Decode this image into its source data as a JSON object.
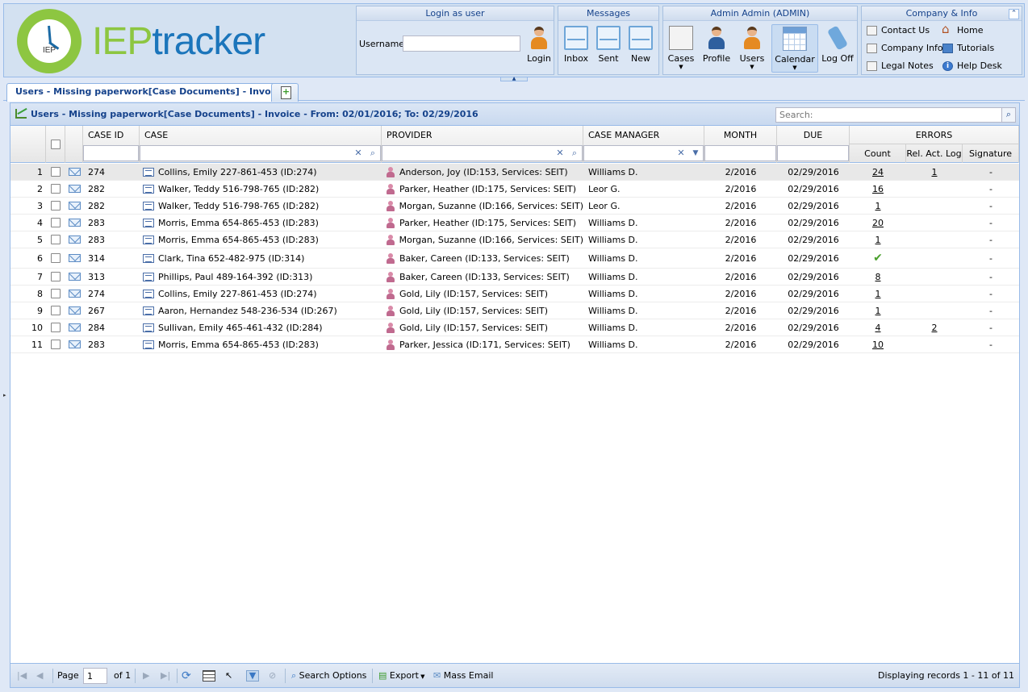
{
  "logo": {
    "badge": "IEP",
    "prefix": "IEP",
    "suffix": "tracker"
  },
  "login_group": {
    "title": "Login as user",
    "username_label": "Username:",
    "username_value": "",
    "login_label": "Login"
  },
  "messages_group": {
    "title": "Messages",
    "inbox": "Inbox",
    "sent": "Sent",
    "new": "New"
  },
  "admin_group": {
    "title": "Admin Admin (ADMIN)",
    "cases": "Cases",
    "profile": "Profile",
    "users": "Users",
    "calendar": "Calendar",
    "logoff": "Log Off"
  },
  "company_group": {
    "title": "Company & Info",
    "contact": "Contact Us",
    "home": "Home",
    "company_info": "Company Info",
    "tutorials": "Tutorials",
    "legal": "Legal Notes",
    "help": "Help Desk"
  },
  "tabs": [
    {
      "label": "Users - Missing paperwork[Case Documents] - Invoice"
    }
  ],
  "panel": {
    "title": "Users - Missing paperwork[Case Documents] - Invoice - From: 02/01/2016; To: 02/29/2016",
    "search_placeholder": "Search:"
  },
  "columns": {
    "case_id": "CASE ID",
    "case": "CASE",
    "provider": "PROVIDER",
    "case_manager": "CASE MANAGER",
    "month": "MONTH",
    "due": "DUE",
    "errors": "ERRORS",
    "count": "Count",
    "rel_act_log": "Rel. Act. Log",
    "signature": "Signature"
  },
  "rows": [
    {
      "n": "1",
      "case_id": "274",
      "case": "Collins, Emily 227-861-453 (ID:274)",
      "provider": "Anderson, Joy (ID:153, Services: SEIT)",
      "manager": "Williams D.",
      "month": "2/2016",
      "due": "02/29/2016",
      "count": "24",
      "rel": "1",
      "sig": "-"
    },
    {
      "n": "2",
      "case_id": "282",
      "case": "Walker, Teddy 516-798-765 (ID:282)",
      "provider": "Parker, Heather (ID:175, Services: SEIT)",
      "manager": "Leor G.",
      "month": "2/2016",
      "due": "02/29/2016",
      "count": "16",
      "rel": "",
      "sig": "-"
    },
    {
      "n": "3",
      "case_id": "282",
      "case": "Walker, Teddy 516-798-765 (ID:282)",
      "provider": "Morgan, Suzanne (ID:166, Services: SEIT)",
      "manager": "Leor G.",
      "month": "2/2016",
      "due": "02/29/2016",
      "count": "1",
      "rel": "",
      "sig": "-"
    },
    {
      "n": "4",
      "case_id": "283",
      "case": "Morris, Emma 654-865-453 (ID:283)",
      "provider": "Parker, Heather (ID:175, Services: SEIT)",
      "manager": "Williams D.",
      "month": "2/2016",
      "due": "02/29/2016",
      "count": "20",
      "rel": "",
      "sig": "-"
    },
    {
      "n": "5",
      "case_id": "283",
      "case": "Morris, Emma 654-865-453 (ID:283)",
      "provider": "Morgan, Suzanne (ID:166, Services: SEIT)",
      "manager": "Williams D.",
      "month": "2/2016",
      "due": "02/29/2016",
      "count": "1",
      "rel": "",
      "sig": "-"
    },
    {
      "n": "6",
      "case_id": "314",
      "case": "Clark, Tina 652-482-975 (ID:314)",
      "provider": "Baker, Careen (ID:133, Services: SEIT)",
      "manager": "Williams D.",
      "month": "2/2016",
      "due": "02/29/2016",
      "count": "✔",
      "rel": "",
      "sig": "-"
    },
    {
      "n": "7",
      "case_id": "313",
      "case": "Phillips, Paul 489-164-392 (ID:313)",
      "provider": "Baker, Careen (ID:133, Services: SEIT)",
      "manager": "Williams D.",
      "month": "2/2016",
      "due": "02/29/2016",
      "count": "8",
      "rel": "",
      "sig": "-"
    },
    {
      "n": "8",
      "case_id": "274",
      "case": "Collins, Emily 227-861-453 (ID:274)",
      "provider": "Gold, Lily (ID:157, Services: SEIT)",
      "manager": "Williams D.",
      "month": "2/2016",
      "due": "02/29/2016",
      "count": "1",
      "rel": "",
      "sig": "-"
    },
    {
      "n": "9",
      "case_id": "267",
      "case": "Aaron, Hernandez 548-236-534 (ID:267)",
      "provider": "Gold, Lily (ID:157, Services: SEIT)",
      "manager": "Williams D.",
      "month": "2/2016",
      "due": "02/29/2016",
      "count": "1",
      "rel": "",
      "sig": "-"
    },
    {
      "n": "10",
      "case_id": "284",
      "case": "Sullivan, Emily 465-461-432 (ID:284)",
      "provider": "Gold, Lily (ID:157, Services: SEIT)",
      "manager": "Williams D.",
      "month": "2/2016",
      "due": "02/29/2016",
      "count": "4",
      "rel": "2",
      "sig": "-"
    },
    {
      "n": "11",
      "case_id": "283",
      "case": "Morris, Emma 654-865-453 (ID:283)",
      "provider": "Parker, Jessica (ID:171, Services: SEIT)",
      "manager": "Williams D.",
      "month": "2/2016",
      "due": "02/29/2016",
      "count": "10",
      "rel": "",
      "sig": "-"
    }
  ],
  "paging": {
    "page_label": "Page",
    "page_value": "1",
    "of_label": "of 1",
    "search_options": "Search Options",
    "export": "Export",
    "mass_email": "Mass Email",
    "status": "Displaying records 1 - 11 of 11"
  }
}
